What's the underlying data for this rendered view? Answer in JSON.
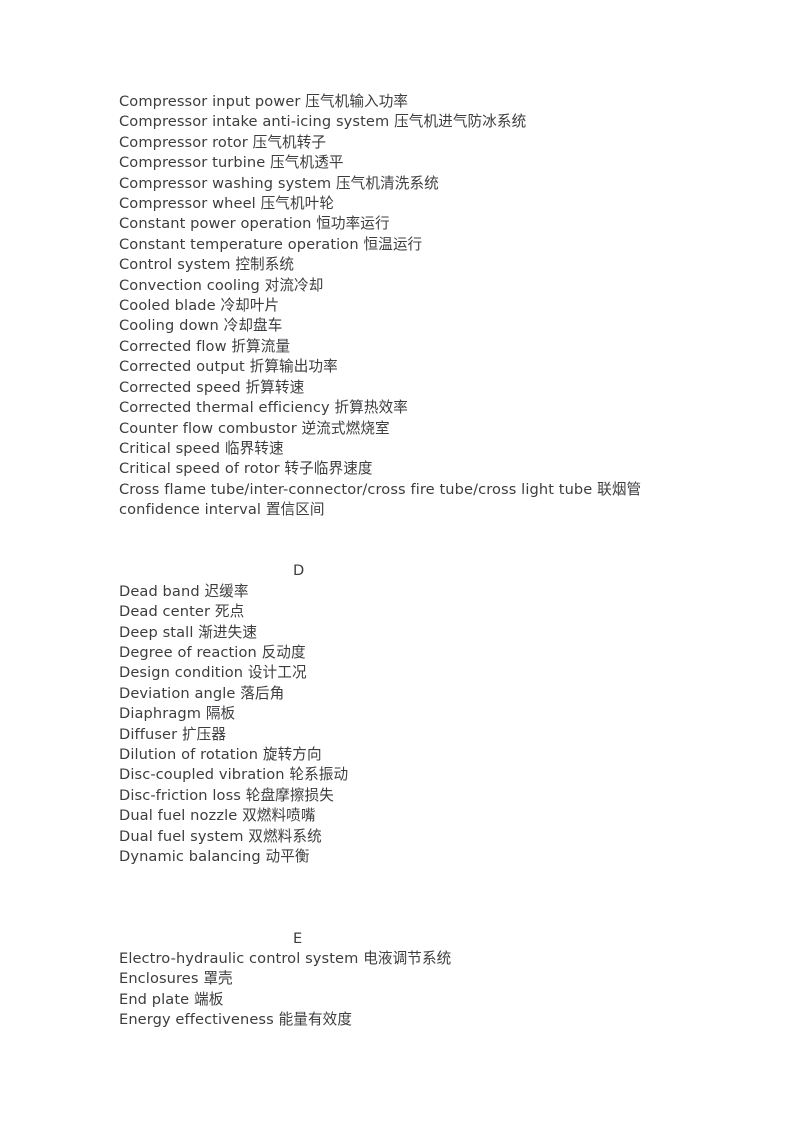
{
  "document": {
    "type": "bilingual-glossary",
    "subject": "gas turbine terminology",
    "page_background": "#ffffff",
    "text_color": "#3d3d40"
  },
  "sections": [
    {
      "letter": "",
      "show_letter": false,
      "entries": [
        {
          "en": "Compressor input power",
          "zh": "压气机输入功率"
        },
        {
          "en": "Compressor intake anti-icing system",
          "zh": "压气机进气防冰系统"
        },
        {
          "en": "Compressor rotor",
          "zh": "压气机转子"
        },
        {
          "en": "Compressor turbine",
          "zh": "压气机透平"
        },
        {
          "en": "Compressor washing system",
          "zh": "压气机清洗系统"
        },
        {
          "en": "Compressor wheel",
          "zh": "压气机叶轮"
        },
        {
          "en": "Constant power operation",
          "zh": "恒功率运行"
        },
        {
          "en": "Constant temperature operation",
          "zh": "恒温运行"
        },
        {
          "en": "Control system",
          "zh": "控制系统"
        },
        {
          "en": "Convection cooling",
          "zh": "对流冷却"
        },
        {
          "en": "Cooled blade",
          "zh": "冷却叶片"
        },
        {
          "en": "Cooling down",
          "zh": "冷却盘车"
        },
        {
          "en": "Corrected flow",
          "zh": "折算流量"
        },
        {
          "en": "Corrected output",
          "zh": "折算输出功率"
        },
        {
          "en": "Corrected speed",
          "zh": "折算转速"
        },
        {
          "en": "Corrected thermal efficiency",
          "zh": "折算热效率"
        },
        {
          "en": "Counter flow combustor",
          "zh": "逆流式燃烧室"
        },
        {
          "en": "Critical speed",
          "zh": "临界转速"
        },
        {
          "en": "Critical speed of rotor",
          "zh": "转子临界速度"
        },
        {
          "en": "Cross flame tube/inter-connector/cross fire tube/cross light tube",
          "zh": "联烟管"
        },
        {
          "en": "confidence interval",
          "zh": "置信区间"
        }
      ]
    },
    {
      "letter": "D",
      "show_letter": true,
      "entries": [
        {
          "en": "Dead band",
          "zh": "迟缓率"
        },
        {
          "en": "Dead center",
          "zh": "死点"
        },
        {
          "en": "Deep stall",
          "zh": "渐进失速"
        },
        {
          "en": "Degree of reaction",
          "zh": "反动度"
        },
        {
          "en": "Design condition",
          "zh": "设计工况"
        },
        {
          "en": "Deviation angle",
          "zh": "落后角"
        },
        {
          "en": "Diaphragm",
          "zh": "隔板"
        },
        {
          "en": "Diffuser",
          "zh": "扩压器"
        },
        {
          "en": "Dilution of rotation",
          "zh": "旋转方向"
        },
        {
          "en": "Disc-coupled vibration",
          "zh": "轮系振动"
        },
        {
          "en": "Disc-friction loss",
          "zh": "轮盘摩擦损失"
        },
        {
          "en": "Dual fuel nozzle",
          "zh": "双燃料喷嘴"
        },
        {
          "en": "Dual fuel system",
          "zh": "双燃料系统"
        },
        {
          "en": "Dynamic balancing",
          "zh": "动平衡"
        }
      ]
    },
    {
      "letter": "E",
      "show_letter": true,
      "entries": [
        {
          "en": "Electro-hydraulic control system",
          "zh": "电液调节系统"
        },
        {
          "en": "Enclosures",
          "zh": "罩壳"
        },
        {
          "en": "End plate",
          "zh": "端板"
        },
        {
          "en": "Energy effectiveness",
          "zh": "能量有效度"
        }
      ]
    }
  ]
}
